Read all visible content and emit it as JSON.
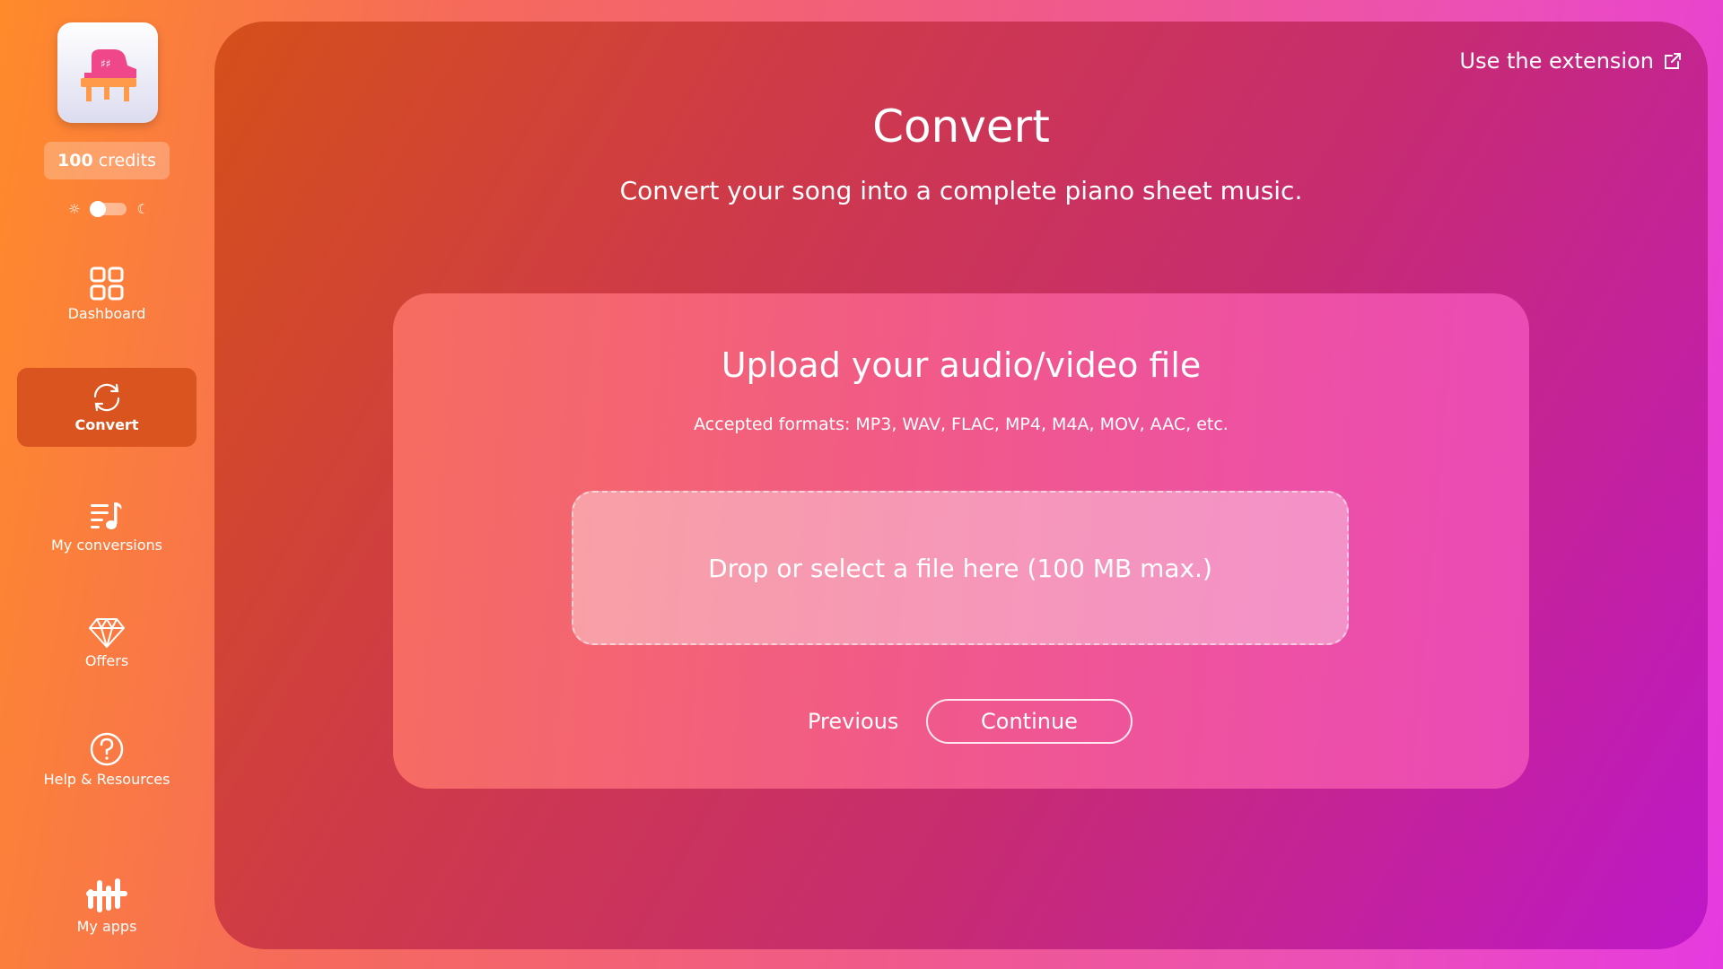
{
  "sidebar": {
    "logo_icon": "piano-logo-icon",
    "credits": {
      "amount": "100",
      "label": "credits"
    },
    "theme": {
      "light_icon": "sun-icon",
      "dark_icon": "moon-icon"
    },
    "items": [
      {
        "label": "Dashboard",
        "icon": "grid-icon"
      },
      {
        "label": "Convert",
        "icon": "refresh-icon",
        "active": true
      },
      {
        "label": "My conversions",
        "icon": "music-list-icon"
      },
      {
        "label": "Offers",
        "icon": "diamond-icon"
      },
      {
        "label": "Help & Resources",
        "icon": "question-icon"
      },
      {
        "label": "My apps",
        "icon": "apps-logo-icon"
      }
    ]
  },
  "header": {
    "extension_link": "Use the extension",
    "title": "Convert",
    "subtitle": "Convert your song into a complete piano sheet music."
  },
  "upload": {
    "title": "Upload your audio/video file",
    "formats": "Accepted formats: MP3, WAV, FLAC, MP4, M4A, MOV, AAC, etc.",
    "dropzone": "Drop or select a file here (100 MB max.)",
    "previous": "Previous",
    "continue": "Continue"
  },
  "colors": {
    "active_nav": "#d9541e",
    "accent_orange": "#ff8a2a",
    "accent_magenta": "#e63ae0"
  }
}
